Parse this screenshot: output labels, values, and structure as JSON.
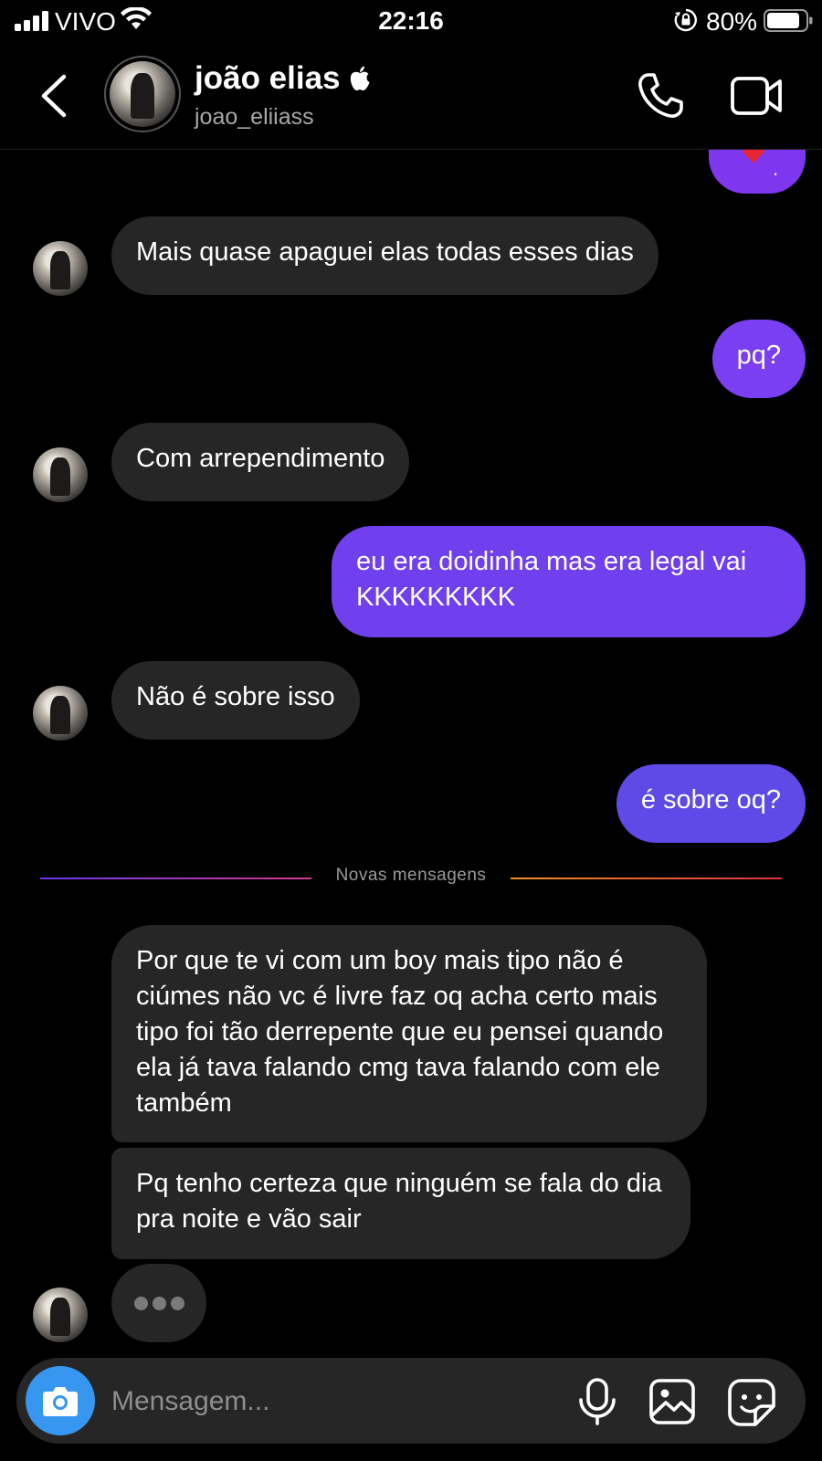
{
  "status_bar": {
    "carrier": "VIVO",
    "time": "22:16",
    "battery": "80%"
  },
  "header": {
    "name": "joão elias",
    "username": "joao_eliiass"
  },
  "messages": [
    {
      "side": "in",
      "text": "Mais quase apaguei elas todas esses dias"
    },
    {
      "side": "out",
      "text": "pq?"
    },
    {
      "side": "in",
      "text": "Com arrependimento"
    },
    {
      "side": "out",
      "text": "eu era doidinha mas era legal vai KKKKKKKKK"
    },
    {
      "side": "in",
      "text": "Não é sobre isso"
    },
    {
      "side": "out",
      "text": "é sobre oq?"
    },
    {
      "side": "in",
      "text": "Por que te vi com um boy mais tipo não é ciúmes não vc é livre faz oq acha certo mais tipo foi tão derrepente que eu pensei quando ela já tava falando cmg tava falando com ele também"
    },
    {
      "side": "in",
      "text": "Pq tenho certeza que ninguém se fala do dia pra noite e vão sair"
    }
  ],
  "divider_label": "Novas mensagens",
  "composer": {
    "placeholder": "Mensagem..."
  },
  "colors": {
    "outgoing_bubble": "#7b3cf0",
    "incoming_bubble": "#262626",
    "camera_button": "#3797f0"
  },
  "icons": [
    "signal-icon",
    "wifi-icon",
    "rotation-lock-icon",
    "battery-icon",
    "back-chevron-icon",
    "apple-icon",
    "phone-icon",
    "video-camera-icon",
    "heart-emoji-icon",
    "camera-icon",
    "microphone-icon",
    "gallery-icon",
    "sticker-icon"
  ]
}
